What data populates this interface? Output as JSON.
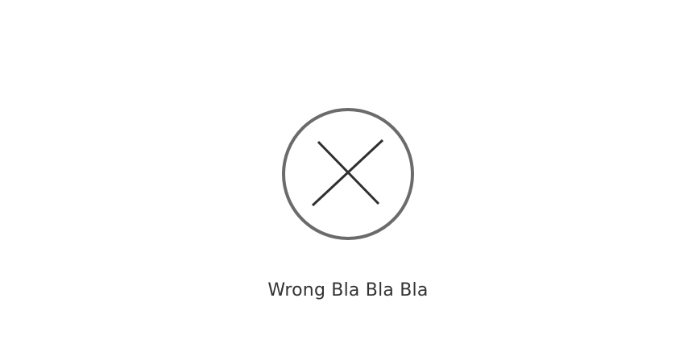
{
  "status": {
    "icon": "close-circle-icon",
    "message": "Wrong Bla Bla Bla",
    "circle_color": "#6b6b6b",
    "cross_color": "#2f2f2f"
  }
}
